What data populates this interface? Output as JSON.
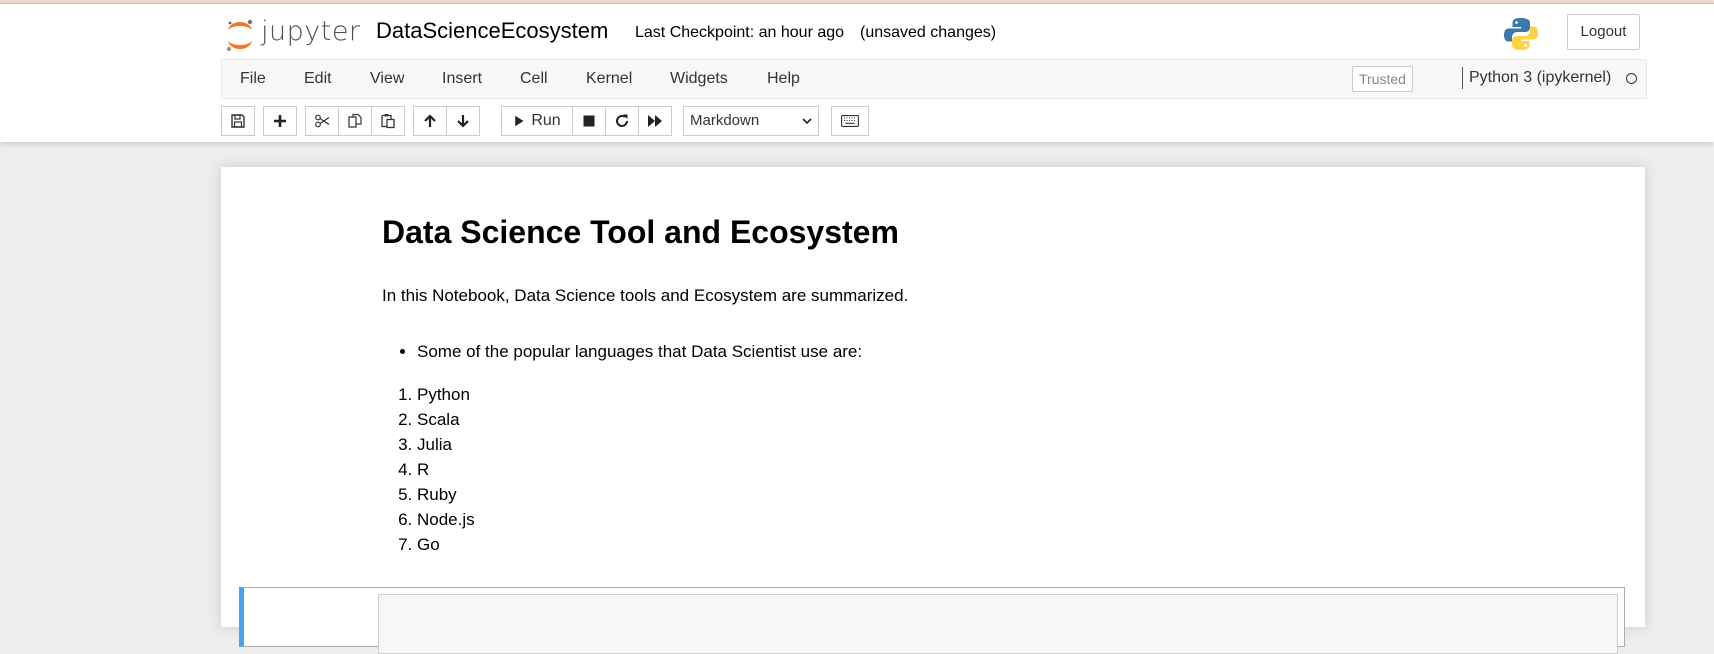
{
  "header": {
    "logo_text": "jupyter",
    "notebook_name": "DataScienceEcosystem",
    "checkpoint": "Last Checkpoint: an hour ago",
    "autosave_status": "(unsaved changes)",
    "logout_label": "Logout"
  },
  "menubar": {
    "items": [
      "File",
      "Edit",
      "View",
      "Insert",
      "Cell",
      "Kernel",
      "Widgets",
      "Help"
    ],
    "trusted": "Trusted",
    "kernel": "Python 3 (ipykernel)"
  },
  "toolbar": {
    "run_label": "Run",
    "cell_type": "Markdown"
  },
  "cell": {
    "heading": "Data Science Tool and Ecosystem",
    "intro": "In this Notebook, Data Science tools and Ecosystem are summarized.",
    "bullet": "Some of the popular languages that Data Scientist use are:",
    "languages": [
      "Python",
      "Scala",
      "Julia",
      "R",
      "Ruby",
      "Node.js",
      "Go"
    ]
  },
  "colors": {
    "jupyter_orange": "#f37726",
    "selected_cell_border": "#42a5f5"
  }
}
